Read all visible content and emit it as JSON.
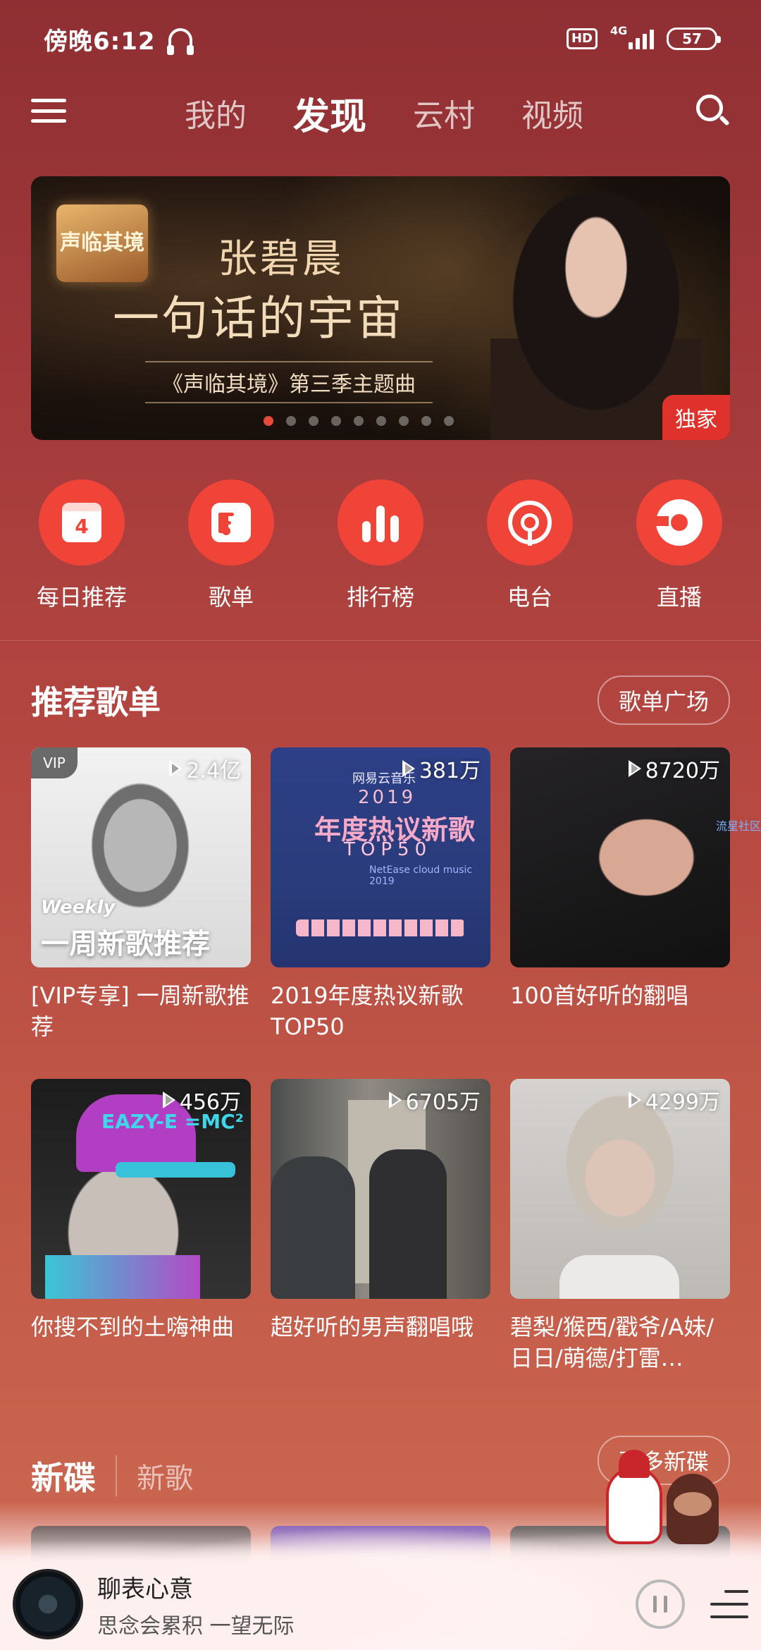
{
  "status_bar": {
    "time": "傍晚6:12",
    "hd": "HD",
    "network": "4G",
    "battery": "57"
  },
  "top_nav": {
    "tabs": [
      "我的",
      "发现",
      "云村",
      "视频"
    ],
    "active_tab": "发现"
  },
  "banner": {
    "logo_text": "声临其境",
    "artist": "张碧晨",
    "title": "一句话的宇宙",
    "subtitle": "《声临其境》第三季主题曲",
    "badge": "独家",
    "dots": 9,
    "active_dot": 0
  },
  "quick_entries": [
    {
      "label": "每日推荐",
      "icon": "calendar-icon",
      "badge": "4"
    },
    {
      "label": "歌单",
      "icon": "playlist-icon"
    },
    {
      "label": "排行榜",
      "icon": "chart-bars-icon"
    },
    {
      "label": "电台",
      "icon": "radio-icon"
    },
    {
      "label": "直播",
      "icon": "live-icon"
    }
  ],
  "recommended": {
    "title": "推荐歌单",
    "more_label": "歌单广场",
    "cards": [
      {
        "title": "[VIP专享] 一周新歌推荐",
        "plays": "2.4亿",
        "vip": "VIP",
        "cover_text_small": "Weekly",
        "cover_text_big": "一周新歌推荐"
      },
      {
        "title": "2019年度热议新歌TOP50",
        "plays": "381万",
        "cover_brand": "网易云音乐",
        "cover_year": "2019",
        "cover_heading": "年度热议新歌",
        "cover_top": "TOP50",
        "cover_small": "NetEase cloud music 2019"
      },
      {
        "title": "100首好听的翻唱",
        "plays": "8720万"
      },
      {
        "title": "你搜不到的土嗨神曲",
        "plays": "456万",
        "cover_text": "EAZY-E =MC²"
      },
      {
        "title": "超好听的男声翻唱哦",
        "plays": "6705万"
      },
      {
        "title": "碧梨/猴西/戳爷/A妹/日日/萌德/打雷…",
        "plays": "4299万"
      }
    ],
    "watermark": "流星社区"
  },
  "new_section": {
    "title": "新碟",
    "subtitle": "新歌",
    "more_label": "更多新碟"
  },
  "player": {
    "song": "聊表心意",
    "lyric": "思念会累积 一望无际"
  },
  "colors": {
    "accent": "#ef4437",
    "background_top": "#8f2f33",
    "background_bottom": "#cd6a52",
    "badge_red": "#e0322c"
  }
}
